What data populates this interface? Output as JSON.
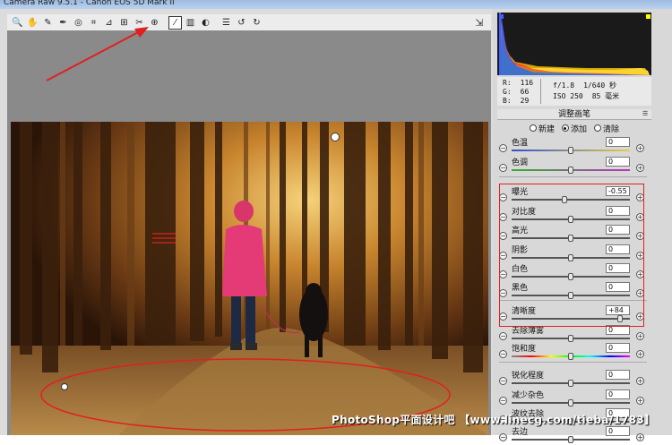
{
  "window": {
    "title": "Camera Raw 9.5.1 - Canon EOS 5D Mark II"
  },
  "toolbar": {
    "tools": [
      {
        "name": "zoom-icon",
        "glyph": "🔍"
      },
      {
        "name": "hand-icon",
        "glyph": "✋"
      },
      {
        "name": "white-balance-icon",
        "glyph": "✎"
      },
      {
        "name": "color-sampler-icon",
        "glyph": "✒"
      },
      {
        "name": "targeted-adjust-icon",
        "glyph": "◎"
      },
      {
        "name": "crop-icon",
        "glyph": "⌗"
      },
      {
        "name": "straighten-icon",
        "glyph": "⊿"
      },
      {
        "name": "transform-icon",
        "glyph": "⊞"
      },
      {
        "name": "spot-removal-icon",
        "glyph": "✂"
      },
      {
        "name": "red-eye-icon",
        "glyph": "⊕"
      },
      {
        "name": "adjustment-brush-icon",
        "glyph": "⁄"
      },
      {
        "name": "graduated-filter-icon",
        "glyph": "▥"
      },
      {
        "name": "radial-filter-icon",
        "glyph": "◐"
      },
      {
        "name": "preferences-icon",
        "glyph": "☰"
      },
      {
        "name": "rotate-ccw-icon",
        "glyph": "↺"
      },
      {
        "name": "rotate-cw-icon",
        "glyph": "↻"
      }
    ],
    "active_tool": "adjustment-brush-icon"
  },
  "readout": {
    "r_label": "R:",
    "r_value": "116",
    "g_label": "G:",
    "g_value": "66",
    "b_label": "B:",
    "b_value": "29",
    "aperture": "f/1.8",
    "shutter": "1/640 秒",
    "iso": "ISO 250",
    "focal": "85 毫米"
  },
  "panel": {
    "title": "调整画笔",
    "modes": [
      {
        "label": "新建",
        "selected": false
      },
      {
        "label": "添加",
        "selected": true
      },
      {
        "label": "清除",
        "selected": false
      }
    ]
  },
  "sliders": [
    {
      "label": "色温",
      "value": "0",
      "pos": 0.5,
      "track": "temp"
    },
    {
      "label": "色调",
      "value": "0",
      "pos": 0.5,
      "track": "tint"
    },
    {
      "label": "曝光",
      "value": "-0.55",
      "pos": 0.45,
      "track": "gray"
    },
    {
      "label": "对比度",
      "value": "0",
      "pos": 0.5,
      "track": "gray"
    },
    {
      "label": "高光",
      "value": "0",
      "pos": 0.5,
      "track": "gray"
    },
    {
      "label": "阴影",
      "value": "0",
      "pos": 0.5,
      "track": "gray"
    },
    {
      "label": "白色",
      "value": "0",
      "pos": 0.5,
      "track": "gray"
    },
    {
      "label": "黑色",
      "value": "0",
      "pos": 0.5,
      "track": "gray"
    },
    {
      "label": "清晰度",
      "value": "+84",
      "pos": 0.92,
      "track": "gray"
    },
    {
      "label": "去除薄雾",
      "value": "0",
      "pos": 0.5,
      "track": "gray"
    },
    {
      "label": "饱和度",
      "value": "0",
      "pos": 0.5,
      "track": "sat"
    },
    {
      "label": "锐化程度",
      "value": "0",
      "pos": 0.5,
      "track": "gray"
    },
    {
      "label": "减少杂色",
      "value": "0",
      "pos": 0.5,
      "track": "gray"
    },
    {
      "label": "波纹去除",
      "value": "0",
      "pos": 0.5,
      "track": "gray"
    },
    {
      "label": "去边",
      "value": "0",
      "pos": 0.5,
      "track": "gray"
    }
  ],
  "colors": {
    "accent_red": "#e02020",
    "panel_bg": "#d8d8d8"
  },
  "watermark": "PhotoShop平面设计吧 【www.linecg.com/tieba/1783】"
}
